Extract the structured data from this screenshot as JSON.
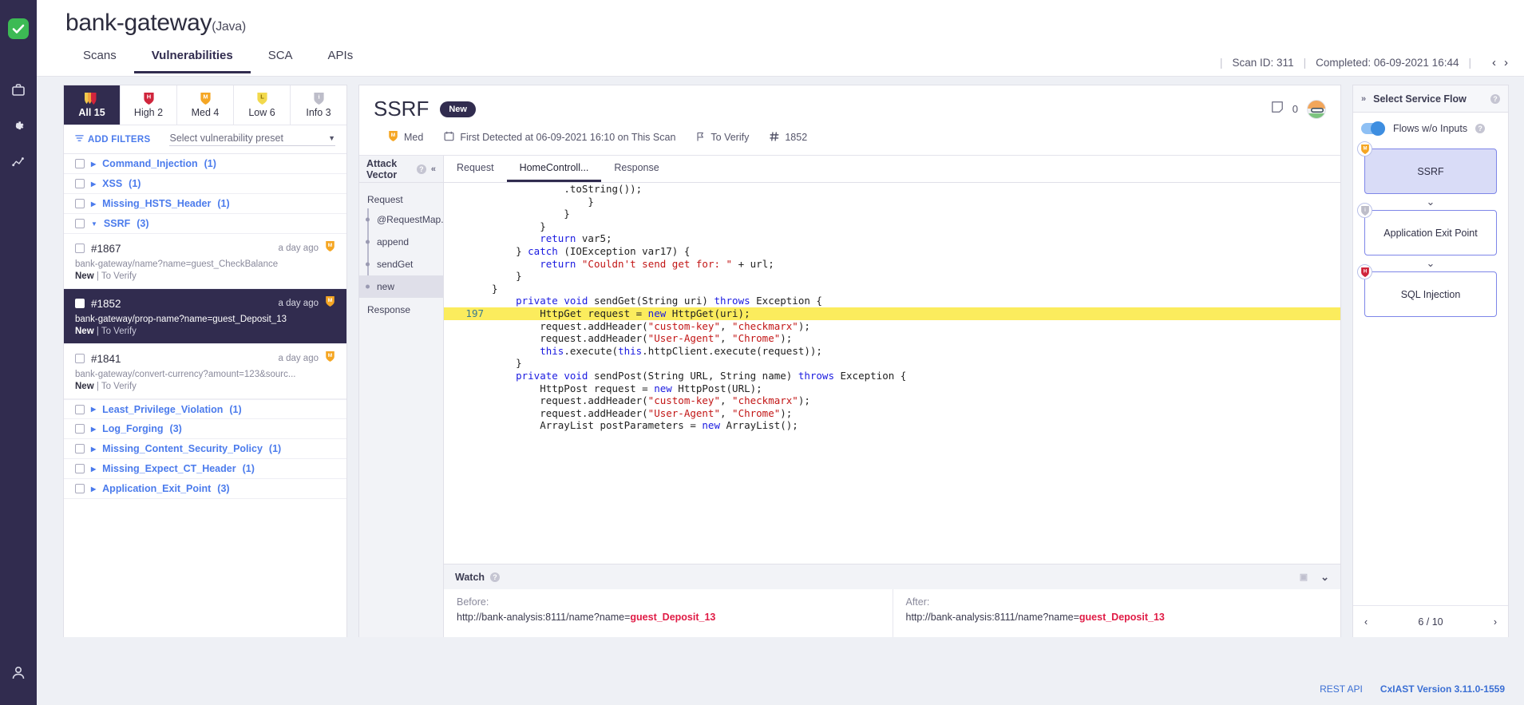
{
  "rail": {
    "logo_icon": "checkmarx-logo-icon",
    "icons": [
      "briefcase-icon",
      "gear-icon",
      "analytics-icon"
    ],
    "bottom_icon": "user-icon"
  },
  "header": {
    "project_name": "bank-gateway",
    "project_lang": "(Java)",
    "tabs": [
      {
        "label": "Scans",
        "active": false
      },
      {
        "label": "Vulnerabilities",
        "active": true
      },
      {
        "label": "SCA",
        "active": false
      },
      {
        "label": "APIs",
        "active": false
      }
    ],
    "scan_id": "Scan ID: 311",
    "completed": "Completed: 06-09-2021 16:44",
    "prev_arrow": "‹",
    "next_arrow": "›"
  },
  "severity_tabs": [
    {
      "label": "All 15",
      "icon": "all-shields-icon",
      "active": true
    },
    {
      "label": "High 2",
      "icon": "high-shield-icon",
      "active": false
    },
    {
      "label": "Med 4",
      "icon": "med-shield-icon",
      "active": false
    },
    {
      "label": "Low 6",
      "icon": "low-shield-icon",
      "active": false
    },
    {
      "label": "Info 3",
      "icon": "info-shield-icon",
      "active": false
    }
  ],
  "filters": {
    "add_filters_label": "ADD FILTERS",
    "filter_icon": "funnel-icon",
    "preset_placeholder": "Select vulnerability preset"
  },
  "vuln_list": [
    {
      "type": "group",
      "name": "Command_Injection",
      "count": "(1)",
      "expanded": false
    },
    {
      "type": "group",
      "name": "XSS",
      "count": "(1)",
      "expanded": false
    },
    {
      "type": "group",
      "name": "Missing_HSTS_Header",
      "count": "(1)",
      "expanded": false
    },
    {
      "type": "group",
      "name": "SSRF",
      "count": "(3)",
      "expanded": true
    },
    {
      "type": "item",
      "id": "#1867",
      "age": "a day ago",
      "url": "bank-gateway/name?name=guest_CheckBalance",
      "state": "New",
      "status": "To Verify",
      "severity": "med-shield-icon",
      "selected": false
    },
    {
      "type": "item",
      "id": "#1852",
      "age": "a day ago",
      "url": "bank-gateway/prop-name?name=guest_Deposit_13",
      "state": "New",
      "status": "To Verify",
      "severity": "med-shield-icon",
      "selected": true
    },
    {
      "type": "item",
      "id": "#1841",
      "age": "a day ago",
      "url": "bank-gateway/convert-currency?amount=123&sourc...",
      "state": "New",
      "status": "To Verify",
      "severity": "med-shield-icon",
      "selected": false
    },
    {
      "type": "group",
      "name": "Least_Privilege_Violation",
      "count": "(1)",
      "expanded": false
    },
    {
      "type": "group",
      "name": "Log_Forging",
      "count": "(3)",
      "expanded": false
    },
    {
      "type": "group",
      "name": "Missing_Content_Security_Policy",
      "count": "(1)",
      "expanded": false
    },
    {
      "type": "group",
      "name": "Missing_Expect_CT_Header",
      "count": "(1)",
      "expanded": false
    },
    {
      "type": "group",
      "name": "Application_Exit_Point",
      "count": "(3)",
      "expanded": false
    }
  ],
  "detail": {
    "title": "SSRF",
    "badge": "New",
    "notes_icon": "note-icon",
    "notes_count": "0",
    "avatar": "user-avatar",
    "severity_label": "Med",
    "severity_icon": "med-shield-icon",
    "first_detected": "First Detected at 06-09-2021 16:10 on This Scan",
    "calendar_icon": "calendar-icon",
    "to_verify": "To Verify",
    "flag_icon": "flag-icon",
    "hash_icon": "hash-icon",
    "vuln_number": "1852"
  },
  "attack_vector": {
    "title": "Attack Vector",
    "collapse_icon": "double-chevron-left-icon",
    "request_label": "Request",
    "response_label": "Response",
    "nodes": [
      {
        "label": "@RequestMap...",
        "active": false
      },
      {
        "label": "append",
        "active": false
      },
      {
        "label": "sendGet",
        "active": false
      },
      {
        "label": "new",
        "active": true
      }
    ]
  },
  "code_tabs": [
    {
      "label": "Request",
      "active": false
    },
    {
      "label": "HomeControll...",
      "active": true
    },
    {
      "label": "Response",
      "active": false
    }
  ],
  "code": {
    "highlight_line": "197",
    "lines": [
      {
        "num": "",
        "segs": [
          {
            "t": "            ",
            "c": ""
          },
          {
            "t": ".toString());",
            "c": ""
          }
        ],
        "clipped": true
      },
      {
        "num": "",
        "segs": [
          {
            "t": "                }",
            "c": ""
          }
        ]
      },
      {
        "num": "",
        "segs": [
          {
            "t": "            }",
            "c": ""
          }
        ]
      },
      {
        "num": "",
        "segs": [
          {
            "t": "",
            "c": ""
          }
        ]
      },
      {
        "num": "",
        "segs": [
          {
            "t": "        }",
            "c": ""
          }
        ]
      },
      {
        "num": "",
        "segs": [
          {
            "t": "",
            "c": ""
          }
        ]
      },
      {
        "num": "",
        "segs": [
          {
            "t": "        ",
            "c": ""
          },
          {
            "t": "return",
            "c": "kw"
          },
          {
            "t": " var5;",
            "c": ""
          }
        ]
      },
      {
        "num": "",
        "segs": [
          {
            "t": "    } ",
            "c": ""
          },
          {
            "t": "catch",
            "c": "kw"
          },
          {
            "t": " (IOException var17) {",
            "c": ""
          }
        ]
      },
      {
        "num": "",
        "segs": [
          {
            "t": "        ",
            "c": ""
          },
          {
            "t": "return",
            "c": "kw"
          },
          {
            "t": " ",
            "c": ""
          },
          {
            "t": "\"Couldn't send get for: \"",
            "c": "str"
          },
          {
            "t": " + url;",
            "c": ""
          }
        ]
      },
      {
        "num": "",
        "segs": [
          {
            "t": "    }",
            "c": ""
          }
        ]
      },
      {
        "num": "",
        "segs": [
          {
            "t": "}",
            "c": ""
          }
        ]
      },
      {
        "num": "",
        "segs": [
          {
            "t": "",
            "c": ""
          }
        ]
      },
      {
        "num": "",
        "segs": [
          {
            "t": "    ",
            "c": ""
          },
          {
            "t": "private void",
            "c": "kw"
          },
          {
            "t": " sendGet(String uri) ",
            "c": ""
          },
          {
            "t": "throws",
            "c": "kw"
          },
          {
            "t": " Exception {",
            "c": ""
          }
        ]
      },
      {
        "num": "197",
        "hl": true,
        "segs": [
          {
            "t": "        HttpGet request = ",
            "c": ""
          },
          {
            "t": "new",
            "c": "kw"
          },
          {
            "t": " HttpGet(uri);",
            "c": ""
          }
        ]
      },
      {
        "num": "",
        "segs": [
          {
            "t": "        request.addHeader(",
            "c": ""
          },
          {
            "t": "\"custom-key\"",
            "c": "str"
          },
          {
            "t": ", ",
            "c": ""
          },
          {
            "t": "\"checkmarx\"",
            "c": "str"
          },
          {
            "t": ");",
            "c": ""
          }
        ]
      },
      {
        "num": "",
        "segs": [
          {
            "t": "        request.addHeader(",
            "c": ""
          },
          {
            "t": "\"User-Agent\"",
            "c": "str"
          },
          {
            "t": ", ",
            "c": ""
          },
          {
            "t": "\"Chrome\"",
            "c": "str"
          },
          {
            "t": ");",
            "c": ""
          }
        ]
      },
      {
        "num": "",
        "segs": [
          {
            "t": "        ",
            "c": ""
          },
          {
            "t": "this",
            "c": "kw"
          },
          {
            "t": ".execute(",
            "c": ""
          },
          {
            "t": "this",
            "c": "kw"
          },
          {
            "t": ".httpClient.execute(request));",
            "c": ""
          }
        ]
      },
      {
        "num": "",
        "segs": [
          {
            "t": "    }",
            "c": ""
          }
        ]
      },
      {
        "num": "",
        "segs": [
          {
            "t": "",
            "c": ""
          }
        ]
      },
      {
        "num": "",
        "segs": [
          {
            "t": "    ",
            "c": ""
          },
          {
            "t": "private void",
            "c": "kw"
          },
          {
            "t": " sendPost(String URL, String name) ",
            "c": ""
          },
          {
            "t": "throws",
            "c": "kw"
          },
          {
            "t": " Exception {",
            "c": ""
          }
        ]
      },
      {
        "num": "",
        "segs": [
          {
            "t": "        HttpPost request = ",
            "c": ""
          },
          {
            "t": "new",
            "c": "kw"
          },
          {
            "t": " HttpPost(URL);",
            "c": ""
          }
        ]
      },
      {
        "num": "",
        "segs": [
          {
            "t": "        request.addHeader(",
            "c": ""
          },
          {
            "t": "\"custom-key\"",
            "c": "str"
          },
          {
            "t": ", ",
            "c": ""
          },
          {
            "t": "\"checkmarx\"",
            "c": "str"
          },
          {
            "t": ");",
            "c": ""
          }
        ]
      },
      {
        "num": "",
        "segs": [
          {
            "t": "        request.addHeader(",
            "c": ""
          },
          {
            "t": "\"User-Agent\"",
            "c": "str"
          },
          {
            "t": ", ",
            "c": ""
          },
          {
            "t": "\"Chrome\"",
            "c": "str"
          },
          {
            "t": ");",
            "c": ""
          }
        ]
      },
      {
        "num": "",
        "segs": [
          {
            "t": "        ArrayList postParameters = ",
            "c": ""
          },
          {
            "t": "new",
            "c": "kw"
          },
          {
            "t": " ArrayList();",
            "c": ""
          }
        ]
      }
    ]
  },
  "watch": {
    "title": "Watch",
    "before_label": "Before:",
    "before_url": "http://bank-analysis:8111/name?name=",
    "before_highlight": "guest_Deposit_13",
    "after_label": "After:",
    "after_url": "http://bank-analysis:8111/name?name=",
    "after_highlight": "guest_Deposit_13",
    "expand_icon": "chevron-down-icon"
  },
  "service_flow": {
    "title": "Select Service Flow",
    "expand_icon": "double-chevron-right-icon",
    "toggle_label": "Flows w/o Inputs",
    "toggle_on": true,
    "nodes": [
      {
        "label": "SSRF",
        "severity": "med-shield-icon",
        "selected": true
      },
      {
        "label": "Application Exit Point",
        "severity": "info-shield-icon",
        "selected": false
      },
      {
        "label": "SQL Injection",
        "severity": "high-shield-icon",
        "selected": false
      }
    ],
    "pager": "6 / 10",
    "prev": "‹",
    "next": "›"
  },
  "footer": {
    "rest_api": "REST API",
    "version": "CxIAST Version 3.11.0-1559"
  }
}
